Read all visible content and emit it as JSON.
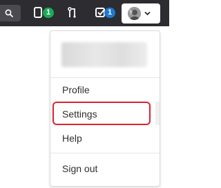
{
  "topbar": {
    "icons": [
      "search-icon",
      "issues-icon",
      "merge-request-icon",
      "todo-icon",
      "chevron-down-icon"
    ],
    "issues_count": "1",
    "todos_count": "1",
    "colors": {
      "bar": "#2d2c30",
      "green_badge": "#1aaa55",
      "blue_badge": "#1f78d1"
    }
  },
  "dropdown": {
    "items": [
      {
        "label": "Profile"
      },
      {
        "label": "Settings"
      },
      {
        "label": "Help"
      },
      {
        "label": "Sign out"
      }
    ],
    "highlight_color": "#d9232e"
  }
}
